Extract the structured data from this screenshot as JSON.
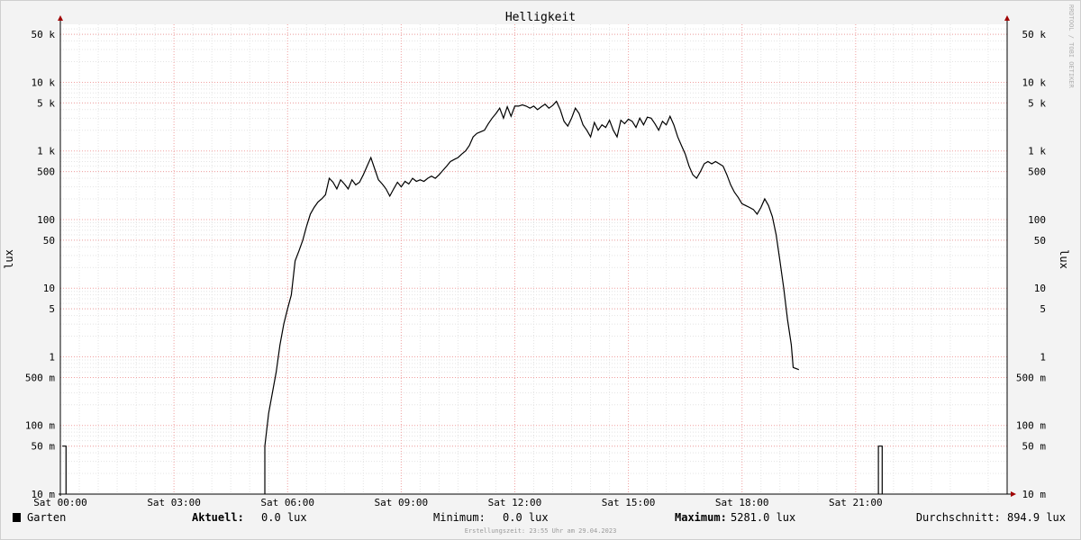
{
  "chart_data": {
    "type": "line",
    "title": "Helligkeit",
    "ylabel_left": "lux",
    "ylabel_right": "lux",
    "watermark": "RRDTOOL / TOBI OETIKER",
    "y_scale": "log",
    "ylim": [
      0.01,
      70000
    ],
    "xlim_hours": [
      0,
      25
    ],
    "grid": true,
    "y_ticks": [
      {
        "value": 0.01,
        "label": "10 m"
      },
      {
        "value": 0.05,
        "label": "50 m"
      },
      {
        "value": 0.1,
        "label": "100 m"
      },
      {
        "value": 0.5,
        "label": "500 m"
      },
      {
        "value": 1,
        "label": "1"
      },
      {
        "value": 5,
        "label": "5"
      },
      {
        "value": 10,
        "label": "10"
      },
      {
        "value": 50,
        "label": "50"
      },
      {
        "value": 100,
        "label": "100"
      },
      {
        "value": 500,
        "label": "500"
      },
      {
        "value": 1000,
        "label": "1 k"
      },
      {
        "value": 5000,
        "label": "5 k"
      },
      {
        "value": 10000,
        "label": "10 k"
      },
      {
        "value": 50000,
        "label": "50 k"
      }
    ],
    "x_ticks": [
      {
        "hour": 0,
        "label": "Sat 00:00"
      },
      {
        "hour": 3,
        "label": "Sat 03:00"
      },
      {
        "hour": 6,
        "label": "Sat 06:00"
      },
      {
        "hour": 9,
        "label": "Sat 09:00"
      },
      {
        "hour": 12,
        "label": "Sat 12:00"
      },
      {
        "hour": 15,
        "label": "Sat 15:00"
      },
      {
        "hour": 18,
        "label": "Sat 18:00"
      },
      {
        "hour": 21,
        "label": "Sat 21:00"
      }
    ],
    "series": [
      {
        "name": "Garten",
        "color": "#000000",
        "segments": [
          [
            [
              0.05,
              0.05
            ],
            [
              0.05,
              0.05
            ],
            [
              0.15,
              0.05
            ],
            [
              0.15,
              0.01
            ]
          ],
          [
            [
              5.4,
              0.01
            ],
            [
              5.4,
              0.05
            ],
            [
              5.5,
              0.15
            ],
            [
              5.6,
              0.3
            ],
            [
              5.7,
              0.6
            ],
            [
              5.8,
              1.5
            ],
            [
              5.9,
              3
            ],
            [
              6.0,
              5
            ],
            [
              6.1,
              8
            ],
            [
              6.2,
              25
            ],
            [
              6.3,
              35
            ],
            [
              6.4,
              50
            ],
            [
              6.5,
              80
            ],
            [
              6.6,
              120
            ],
            [
              6.7,
              150
            ],
            [
              6.8,
              180
            ],
            [
              6.9,
              200
            ],
            [
              7.0,
              230
            ],
            [
              7.1,
              400
            ],
            [
              7.2,
              350
            ],
            [
              7.3,
              280
            ],
            [
              7.4,
              380
            ],
            [
              7.5,
              330
            ],
            [
              7.6,
              280
            ],
            [
              7.7,
              380
            ],
            [
              7.8,
              320
            ],
            [
              7.9,
              350
            ],
            [
              8.0,
              450
            ],
            [
              8.1,
              600
            ],
            [
              8.2,
              800
            ],
            [
              8.3,
              550
            ],
            [
              8.4,
              380
            ],
            [
              8.5,
              330
            ],
            [
              8.6,
              280
            ],
            [
              8.7,
              220
            ],
            [
              8.8,
              280
            ],
            [
              8.9,
              350
            ],
            [
              9.0,
              300
            ],
            [
              9.1,
              360
            ],
            [
              9.2,
              330
            ],
            [
              9.3,
              400
            ],
            [
              9.4,
              360
            ],
            [
              9.5,
              380
            ],
            [
              9.6,
              360
            ],
            [
              9.7,
              400
            ],
            [
              9.8,
              430
            ],
            [
              9.9,
              400
            ],
            [
              10.0,
              450
            ],
            [
              10.1,
              520
            ],
            [
              10.2,
              600
            ],
            [
              10.3,
              700
            ],
            [
              10.4,
              750
            ],
            [
              10.5,
              800
            ],
            [
              10.6,
              900
            ],
            [
              10.7,
              1000
            ],
            [
              10.8,
              1200
            ],
            [
              10.9,
              1600
            ],
            [
              11.0,
              1800
            ],
            [
              11.1,
              1900
            ],
            [
              11.2,
              2000
            ],
            [
              11.3,
              2500
            ],
            [
              11.4,
              3000
            ],
            [
              11.5,
              3500
            ],
            [
              11.6,
              4200
            ],
            [
              11.7,
              3000
            ],
            [
              11.8,
              4400
            ],
            [
              11.9,
              3200
            ],
            [
              12.0,
              4500
            ],
            [
              12.1,
              4500
            ],
            [
              12.2,
              4700
            ],
            [
              12.3,
              4500
            ],
            [
              12.4,
              4200
            ],
            [
              12.5,
              4500
            ],
            [
              12.6,
              4000
            ],
            [
              12.7,
              4400
            ],
            [
              12.8,
              4800
            ],
            [
              12.9,
              4200
            ],
            [
              13.0,
              4600
            ],
            [
              13.1,
              5281
            ],
            [
              13.2,
              4000
            ],
            [
              13.3,
              2700
            ],
            [
              13.4,
              2300
            ],
            [
              13.5,
              3000
            ],
            [
              13.6,
              4200
            ],
            [
              13.7,
              3500
            ],
            [
              13.8,
              2400
            ],
            [
              13.9,
              2000
            ],
            [
              14.0,
              1600
            ],
            [
              14.1,
              2600
            ],
            [
              14.2,
              2000
            ],
            [
              14.3,
              2400
            ],
            [
              14.4,
              2200
            ],
            [
              14.5,
              2800
            ],
            [
              14.6,
              2000
            ],
            [
              14.7,
              1600
            ],
            [
              14.8,
              2800
            ],
            [
              14.9,
              2500
            ],
            [
              15.0,
              2900
            ],
            [
              15.1,
              2700
            ],
            [
              15.2,
              2200
            ],
            [
              15.3,
              3000
            ],
            [
              15.4,
              2400
            ],
            [
              15.5,
              3100
            ],
            [
              15.6,
              3000
            ],
            [
              15.7,
              2500
            ],
            [
              15.8,
              2000
            ],
            [
              15.9,
              2700
            ],
            [
              16.0,
              2400
            ],
            [
              16.1,
              3200
            ],
            [
              16.2,
              2400
            ],
            [
              16.3,
              1600
            ],
            [
              16.4,
              1200
            ],
            [
              16.5,
              900
            ],
            [
              16.6,
              600
            ],
            [
              16.7,
              450
            ],
            [
              16.8,
              400
            ],
            [
              16.9,
              500
            ],
            [
              17.0,
              650
            ],
            [
              17.1,
              700
            ],
            [
              17.2,
              650
            ],
            [
              17.3,
              700
            ],
            [
              17.4,
              650
            ],
            [
              17.5,
              600
            ],
            [
              17.6,
              450
            ],
            [
              17.7,
              320
            ],
            [
              17.8,
              250
            ],
            [
              17.9,
              210
            ],
            [
              18.0,
              170
            ],
            [
              18.1,
              160
            ],
            [
              18.2,
              150
            ],
            [
              18.3,
              140
            ],
            [
              18.4,
              120
            ],
            [
              18.5,
              150
            ],
            [
              18.6,
              200
            ],
            [
              18.7,
              160
            ],
            [
              18.8,
              110
            ],
            [
              18.9,
              60
            ],
            [
              19.0,
              25
            ],
            [
              19.1,
              10
            ],
            [
              19.2,
              3.5
            ],
            [
              19.3,
              1.5
            ],
            [
              19.35,
              0.7
            ],
            [
              19.5,
              0.65
            ]
          ],
          [
            [
              21.6,
              0.01
            ],
            [
              21.6,
              0.05
            ],
            [
              21.7,
              0.05
            ],
            [
              21.7,
              0.01
            ]
          ]
        ]
      }
    ],
    "legend": {
      "series_label": "Garten",
      "current_label": "Aktuell:",
      "current_value": "0.0 lux",
      "min_label": "Minimum:",
      "min_value": "0.0 lux",
      "max_label": "Maximum:",
      "max_value": "5281.0 lux",
      "avg_label": "Durchschnitt:",
      "avg_value": "894.9 lux"
    },
    "footer": "Erstellungszeit: 23:55 Uhr am 29.04.2023"
  }
}
